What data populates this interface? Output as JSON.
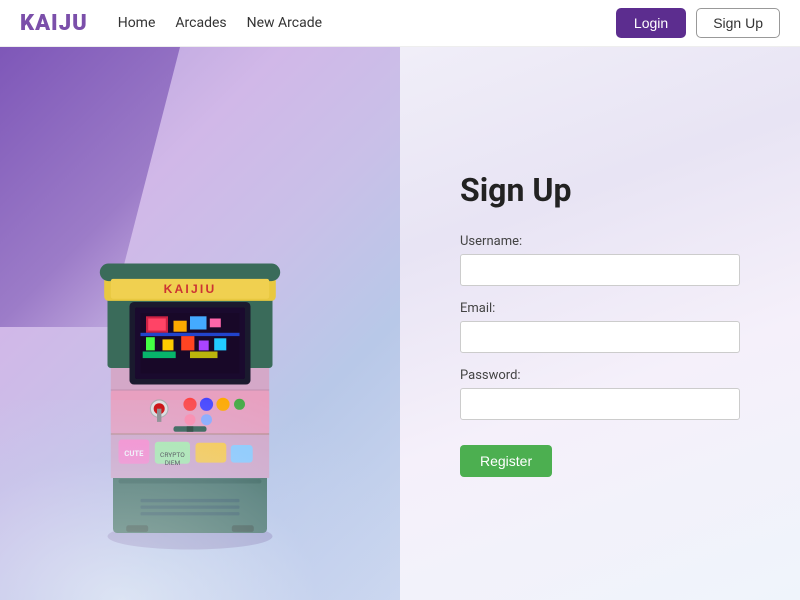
{
  "navbar": {
    "brand": "KAIJU",
    "links": [
      {
        "label": "Home",
        "id": "home"
      },
      {
        "label": "Arcades",
        "id": "arcades"
      },
      {
        "label": "New Arcade",
        "id": "new-arcade"
      }
    ],
    "login_label": "Login",
    "signup_label": "Sign Up"
  },
  "signup": {
    "title": "Sign Up",
    "username_label": "Username:",
    "username_placeholder": "",
    "email_label": "Email:",
    "email_placeholder": "",
    "password_label": "Password:",
    "password_placeholder": "",
    "register_label": "Register"
  },
  "colors": {
    "brand": "#7b4faa",
    "login_bg": "#5c2d8f",
    "register_bg": "#4caf50"
  }
}
